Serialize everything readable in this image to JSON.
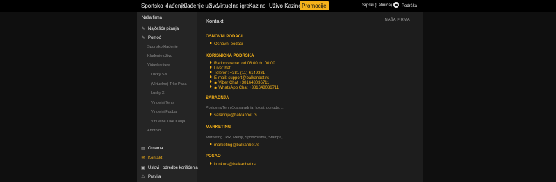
{
  "topnav": {
    "items": [
      "Sportsko klađenje",
      "Klađenje uživo",
      "Virtuelne igre",
      "Kazino",
      "Uživo Kazino",
      "Promocije"
    ],
    "language": "Srpski (Latinica)",
    "support": "Podrška"
  },
  "sidebar": {
    "heading": "Naša firma",
    "faq": "Najčešća pitanja",
    "help": "Pomoć",
    "help_sub": [
      "Sportsko klađenje",
      "Klađenje uživo",
      "Virtuelne igre"
    ],
    "virtual_sub": [
      "Lucky Six",
      "(Virtuelne) Trke Pasa",
      "Lucky X",
      "Virtuelni Tenis",
      "Virtuelni Fudbal",
      "Virtuelne Trke Konja"
    ],
    "android": "Android",
    "about": "O nama",
    "contact": "Kontakt",
    "terms": "Uslovi i odredbe korišćenja",
    "rules": "Pravila"
  },
  "content": {
    "tab": "Kontakt",
    "breadcrumb": "NAŠA FIRMA",
    "sections": {
      "basic": {
        "title": "OSNOVNI PODACI",
        "link": "Osnovni podaci"
      },
      "support": {
        "title": "KORISNIČKA PODRŠKA",
        "lines": [
          "Radno vreme: od 08:00 do 00:00",
          "LiveChat",
          "Telefon: +381 (11) 6149381",
          "E-mail: support@balkanbet.rs",
          "Viber Chat +381648036711",
          "WhatsApp Chat +381648036711"
        ]
      },
      "cooperation": {
        "title": "SARADNJA",
        "desc": "Poslovna/Tehnička saradnja, lokali, ponude, ...",
        "email": "saradnja@balkanbet.rs"
      },
      "marketing": {
        "title": "MARKETING",
        "desc": "Marketing i PR, Mediji, Sponzorstva, Stampa, ...",
        "email": "marketing@balkanbet.rs"
      },
      "jobs": {
        "title": "POSAO",
        "email": "konkurs@balkanbet.rs"
      }
    }
  },
  "colors": {
    "accent": "#f5b21a",
    "background": "#0f0f0f",
    "panel": "#1d1d1d",
    "sidebar": "#252525"
  }
}
